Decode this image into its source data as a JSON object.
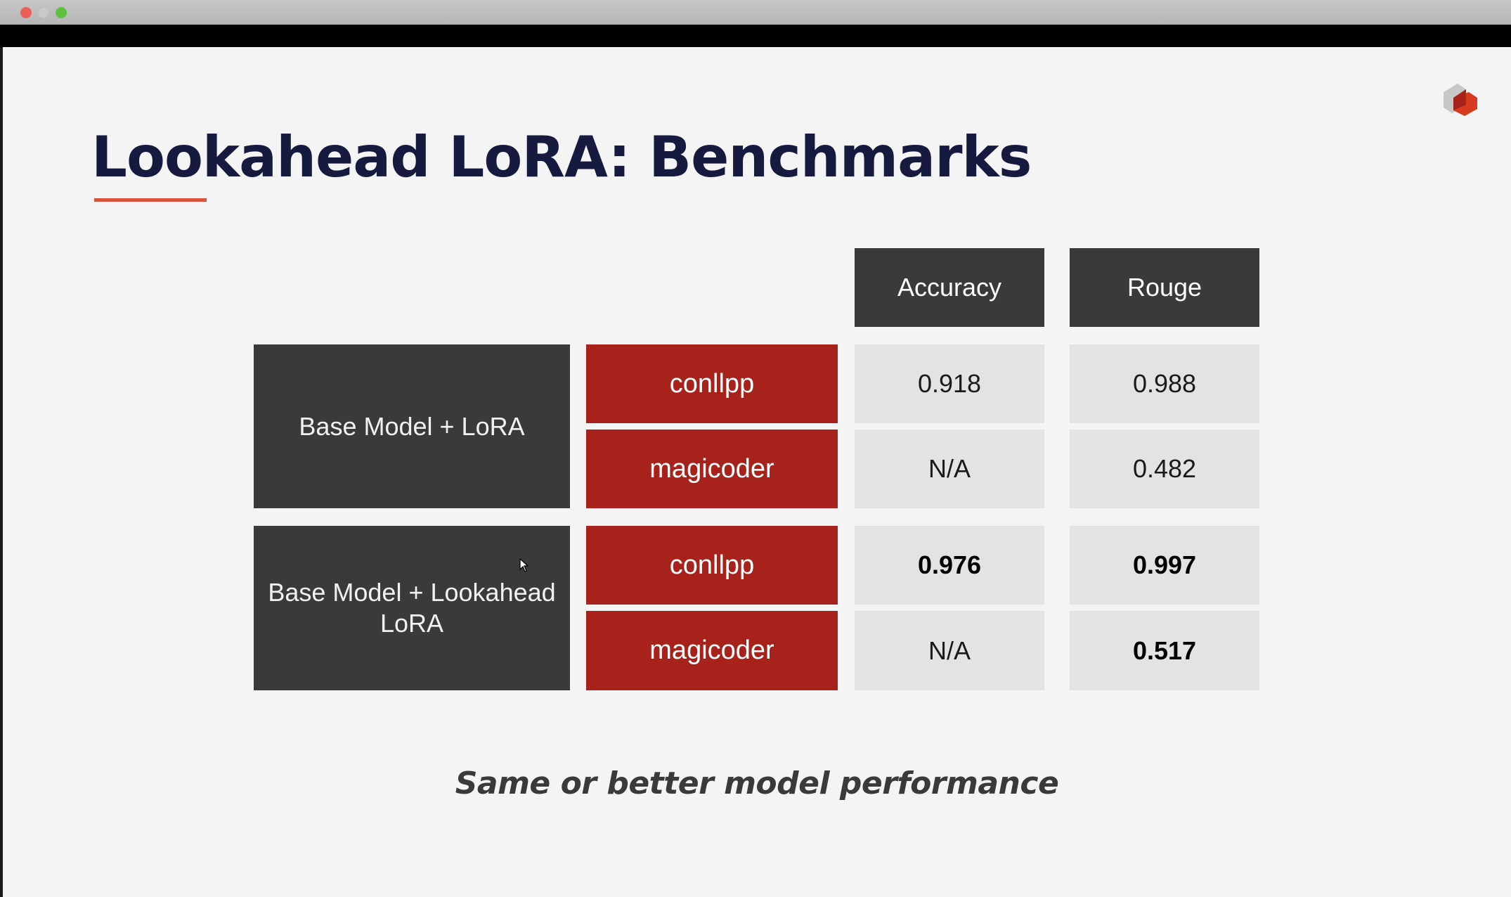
{
  "window": {
    "traffic_lights": [
      "close",
      "minimize",
      "maximize"
    ]
  },
  "slide": {
    "title": "Lookahead LoRA: Benchmarks",
    "caption": "Same or better model performance",
    "accent_color": "#d8513a",
    "title_color": "#171a3f",
    "logo_icon": "brand-logo-icon"
  },
  "table": {
    "headers": [
      "Accuracy",
      "Rouge"
    ],
    "groups": [
      {
        "label": "Base Model + LoRA",
        "rows": [
          {
            "dataset": "conllpp",
            "accuracy": "0.918",
            "rouge": "0.988"
          },
          {
            "dataset": "magicoder",
            "accuracy": "N/A",
            "rouge": "0.482"
          }
        ]
      },
      {
        "label": "Base Model + Lookahead LoRA",
        "rows": [
          {
            "dataset": "conllpp",
            "accuracy": "0.976",
            "rouge": "0.997"
          },
          {
            "dataset": "magicoder",
            "accuracy": "N/A",
            "rouge": "0.517"
          }
        ]
      }
    ],
    "colors": {
      "header_bg": "#3a3a3a",
      "dataset_bg": "#a8221c",
      "value_bg": "#e3e3e3"
    }
  }
}
